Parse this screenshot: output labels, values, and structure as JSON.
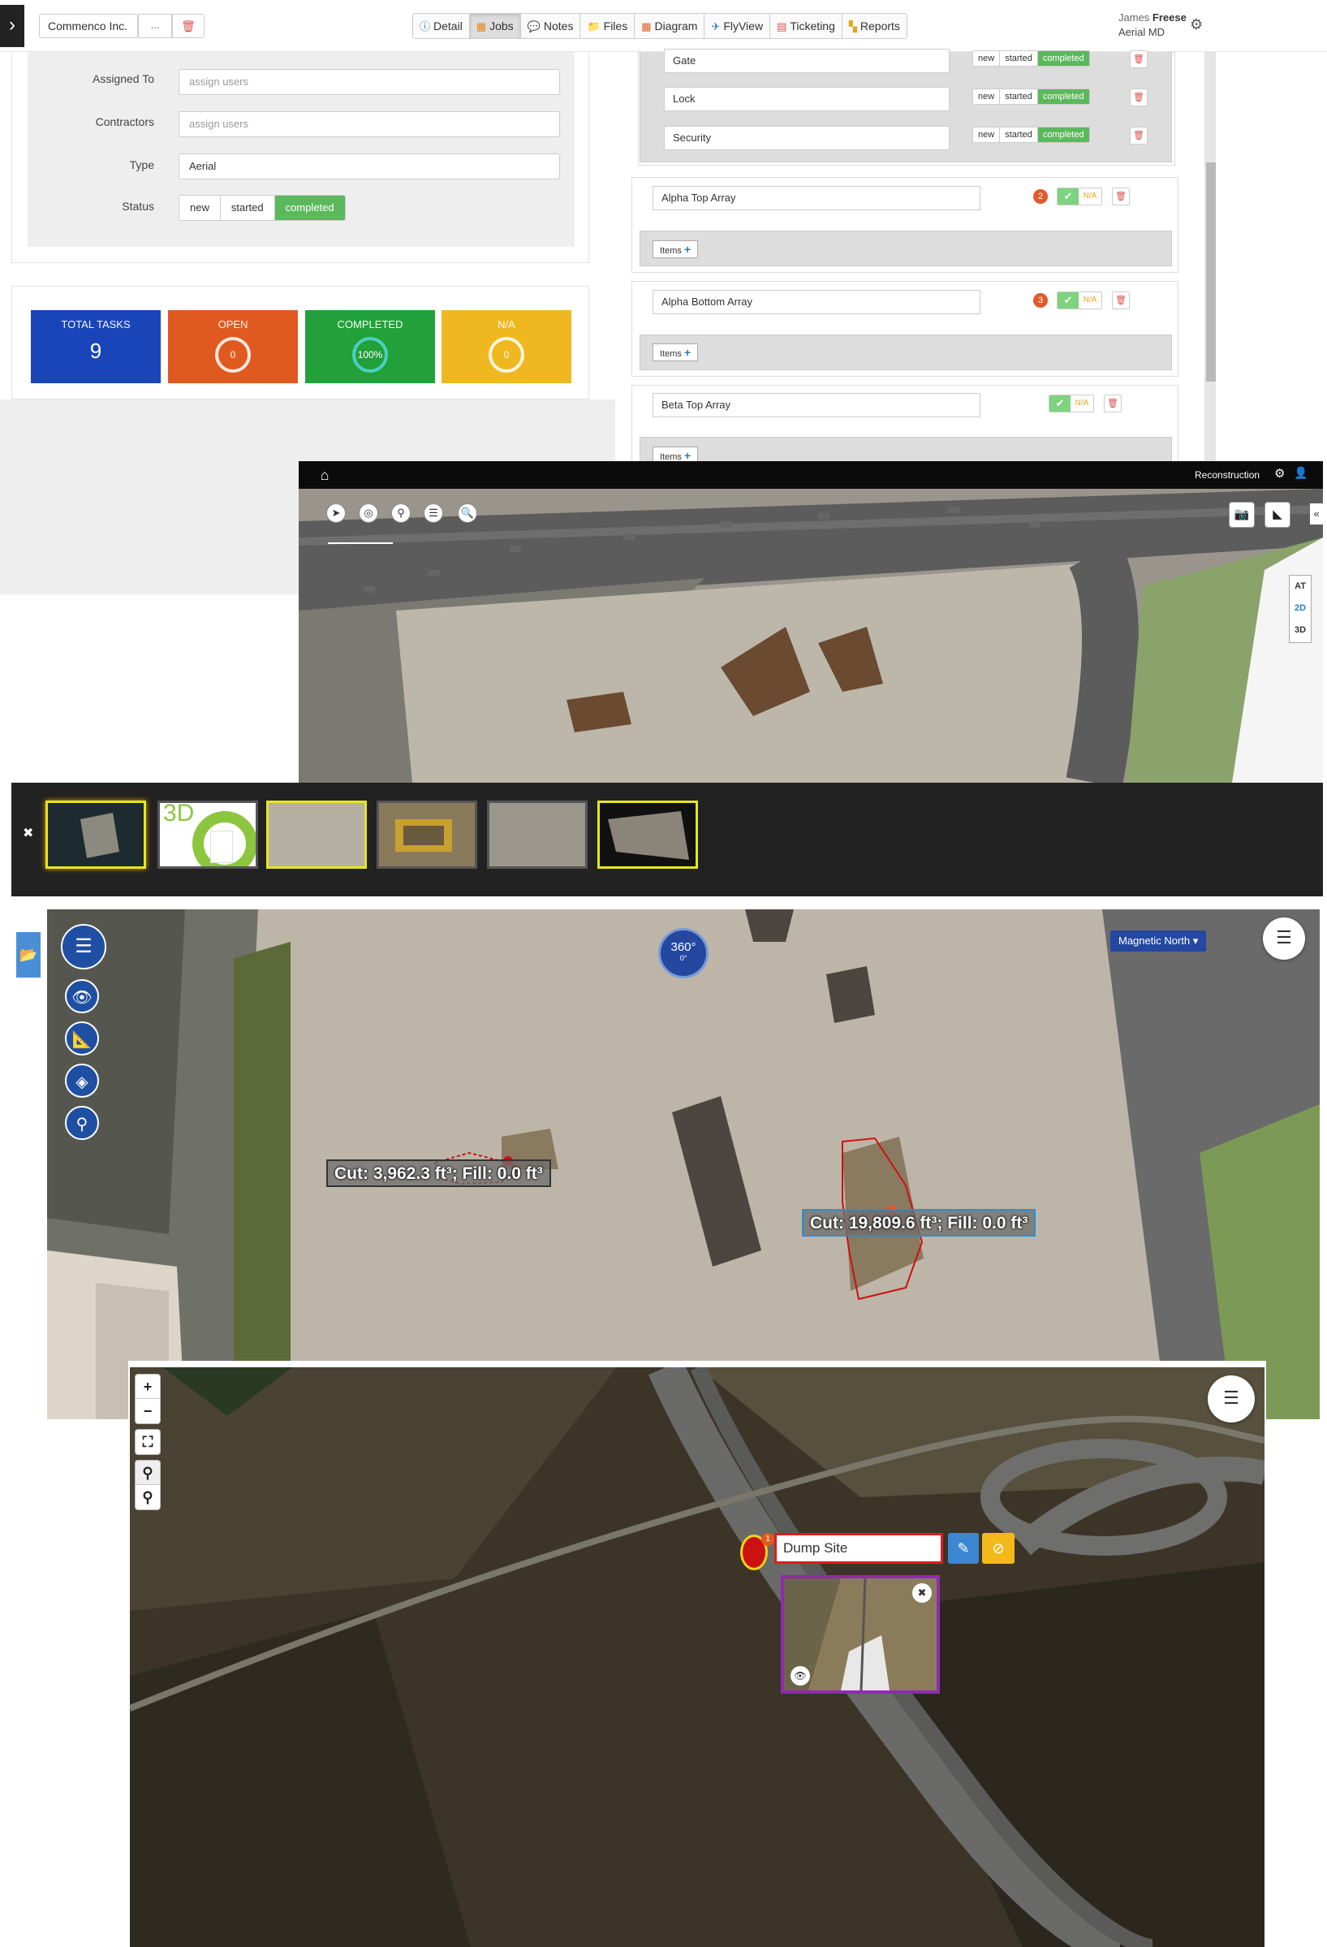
{
  "topbar": {
    "menu_glyph": "›",
    "company": "Commenco Inc.",
    "dots": "...",
    "trash_glyph": "🗑",
    "nav": [
      {
        "icon": "ⓘ",
        "label": "Detail"
      },
      {
        "icon": "▦",
        "label": "Jobs"
      },
      {
        "icon": "💬",
        "label": "Notes"
      },
      {
        "icon": "📁",
        "label": "Files"
      },
      {
        "icon": "▦",
        "label": "Diagram"
      },
      {
        "icon": "✈",
        "label": "FlyView"
      },
      {
        "icon": "▤",
        "label": "Ticketing"
      },
      {
        "icon": "▚",
        "label": "Reports"
      }
    ],
    "active_nav": "Jobs",
    "user_first": "James",
    "user_last": "Freese",
    "user_company": "Aerial MD",
    "gear_glyph": "⚙"
  },
  "job_form": {
    "assigned_label": "Assigned To",
    "assigned_placeholder": "assign users",
    "contractors_label": "Contractors",
    "contractors_placeholder": "assign users",
    "type_label": "Type",
    "type_value": "Aerial",
    "status_label": "Status",
    "status_options": [
      "new",
      "started",
      "completed"
    ],
    "status_selected": "completed"
  },
  "stats": {
    "total_label": "TOTAL TASKS",
    "total_value": "9",
    "open_label": "OPEN",
    "open_value": "0",
    "completed_label": "COMPLETED",
    "completed_value": "100%",
    "na_label": "N/A",
    "na_value": "0",
    "colors": {
      "total": "#1a45b8",
      "open": "#e05a1f",
      "completed": "#22a03a",
      "na": "#f0b820"
    }
  },
  "checklist": {
    "sub_items": [
      {
        "name": "Gate",
        "status": "completed"
      },
      {
        "name": "Lock",
        "status": "completed"
      },
      {
        "name": "Security",
        "status": "completed"
      }
    ],
    "status_options": [
      "new",
      "started",
      "completed"
    ],
    "tasks": [
      {
        "name": "Alpha Top Array",
        "badge": "2",
        "check": "✔",
        "na": "N/A"
      },
      {
        "name": "Alpha Bottom Array",
        "badge": "3",
        "check": "✔",
        "na": "N/A"
      },
      {
        "name": "Beta Top Array",
        "badge": "",
        "check": "✔",
        "na": "N/A"
      }
    ],
    "items_label": "Items",
    "items_plus": "+"
  },
  "map1": {
    "home_glyph": "⌂",
    "title": "Reconstruction",
    "gear_glyph": "⚙",
    "user_glyph": "👤",
    "collapse_glyph": "«",
    "camera_glyph": "📷",
    "measure_glyph": "◣",
    "tools": [
      "➤",
      "◎",
      "⚲",
      "☰",
      "🔍"
    ],
    "dims": [
      "AT",
      "2D",
      "3D"
    ],
    "active_dim": "2D"
  },
  "filmstrip": {
    "close_glyph": "✖",
    "thumb_3d_text": "3D"
  },
  "map2": {
    "folder_glyph": "📂",
    "menu_glyph": "☰",
    "eye_glyph": "👁",
    "ruler_glyph": "📐",
    "layers_glyph": "◈",
    "pin_glyph": "⚲",
    "compass_text": "360°",
    "compass_sub": "0°",
    "north_label": "Magnetic North",
    "list_glyph": "☰",
    "cut1": "Cut: 3,962.3 ft³; Fill: 0.0 ft³",
    "cut2": "Cut: 19,809.6 ft³; Fill: 0.0 ft³"
  },
  "map3": {
    "zoom_in": "+",
    "zoom_out": "−",
    "fullscreen": "⛶",
    "pin": "⚲",
    "pin_alt": "⚲",
    "list_glyph": "☰",
    "marker_badge": "1",
    "poi_name": "Dump Site",
    "edit_glyph": "✎",
    "hide_glyph": "⊘",
    "card_close": "✖",
    "card_eye": "👁"
  }
}
